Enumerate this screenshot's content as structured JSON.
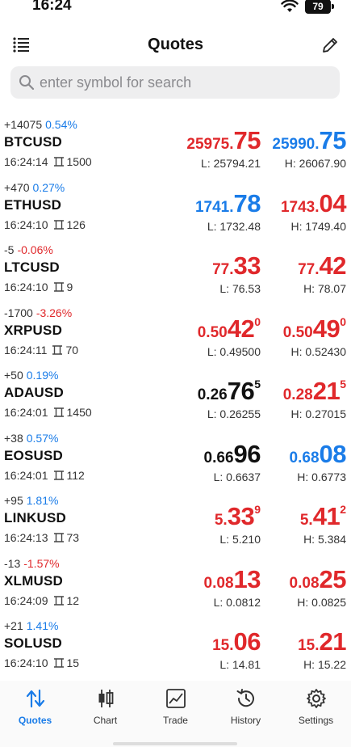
{
  "status": {
    "time": "16:24",
    "battery": "79"
  },
  "header": {
    "title": "Quotes",
    "menu_icon": "list-icon",
    "edit_icon": "pencil-icon"
  },
  "search": {
    "placeholder": "enter symbol for search",
    "icon": "search-icon"
  },
  "colors": {
    "up": "#1a7ce8",
    "down": "#e0282b",
    "neutral": "#111111"
  },
  "quotes": [
    {
      "change": "+14075",
      "pct": "0.54%",
      "dir": "up",
      "symbol": "BTCUSD",
      "time": "16:24:14",
      "spread": "1500",
      "bid": {
        "small": "25975.",
        "big": "75",
        "sup": "",
        "color": "red"
      },
      "ask": {
        "small": "25990.",
        "big": "75",
        "sup": "",
        "color": "blue"
      },
      "low": "L: 25794.21",
      "high": "H: 26067.90"
    },
    {
      "change": "+470",
      "pct": "0.27%",
      "dir": "up",
      "symbol": "ETHUSD",
      "time": "16:24:10",
      "spread": "126",
      "bid": {
        "small": "1741.",
        "big": "78",
        "sup": "",
        "color": "blue"
      },
      "ask": {
        "small": "1743.",
        "big": "04",
        "sup": "",
        "color": "red"
      },
      "low": "L: 1732.48",
      "high": "H: 1749.40"
    },
    {
      "change": "-5",
      "pct": "-0.06%",
      "dir": "down",
      "symbol": "LTCUSD",
      "time": "16:24:10",
      "spread": "9",
      "bid": {
        "small": "77.",
        "big": "33",
        "sup": "",
        "color": "red"
      },
      "ask": {
        "small": "77.",
        "big": "42",
        "sup": "",
        "color": "red"
      },
      "low": "L: 76.53",
      "high": "H: 78.07"
    },
    {
      "change": "-1700",
      "pct": "-3.26%",
      "dir": "down",
      "symbol": "XRPUSD",
      "time": "16:24:11",
      "spread": "70",
      "bid": {
        "small": "0.50",
        "big": "42",
        "sup": "0",
        "color": "red"
      },
      "ask": {
        "small": "0.50",
        "big": "49",
        "sup": "0",
        "color": "red"
      },
      "low": "L: 0.49500",
      "high": "H: 0.52430"
    },
    {
      "change": "+50",
      "pct": "0.19%",
      "dir": "up",
      "symbol": "ADAUSD",
      "time": "16:24:01",
      "spread": "1450",
      "bid": {
        "small": "0.26",
        "big": "76",
        "sup": "5",
        "color": "black"
      },
      "ask": {
        "small": "0.28",
        "big": "21",
        "sup": "5",
        "color": "red"
      },
      "low": "L: 0.26255",
      "high": "H: 0.27015"
    },
    {
      "change": "+38",
      "pct": "0.57%",
      "dir": "up",
      "symbol": "EOSUSD",
      "time": "16:24:01",
      "spread": "112",
      "bid": {
        "small": "0.66",
        "big": "96",
        "sup": "",
        "color": "black"
      },
      "ask": {
        "small": "0.68",
        "big": "08",
        "sup": "",
        "color": "blue"
      },
      "low": "L: 0.6637",
      "high": "H: 0.6773"
    },
    {
      "change": "+95",
      "pct": "1.81%",
      "dir": "up",
      "symbol": "LINKUSD",
      "time": "16:24:13",
      "spread": "73",
      "bid": {
        "small": "5.",
        "big": "33",
        "sup": "9",
        "color": "red"
      },
      "ask": {
        "small": "5.",
        "big": "41",
        "sup": "2",
        "color": "red"
      },
      "low": "L: 5.210",
      "high": "H: 5.384"
    },
    {
      "change": "-13",
      "pct": "-1.57%",
      "dir": "down",
      "symbol": "XLMUSD",
      "time": "16:24:09",
      "spread": "12",
      "bid": {
        "small": "0.08",
        "big": "13",
        "sup": "",
        "color": "red"
      },
      "ask": {
        "small": "0.08",
        "big": "25",
        "sup": "",
        "color": "red"
      },
      "low": "L: 0.0812",
      "high": "H: 0.0825"
    },
    {
      "change": "+21",
      "pct": "1.41%",
      "dir": "up",
      "symbol": "SOLUSD",
      "time": "16:24:10",
      "spread": "15",
      "bid": {
        "small": "15.",
        "big": "06",
        "sup": "",
        "color": "red"
      },
      "ask": {
        "small": "15.",
        "big": "21",
        "sup": "",
        "color": "red"
      },
      "low": "L: 14.81",
      "high": "H: 15.22"
    }
  ],
  "tabs": [
    {
      "label": "Quotes",
      "icon": "quotes-arrows-icon",
      "active": true
    },
    {
      "label": "Chart",
      "icon": "candlestick-icon",
      "active": false
    },
    {
      "label": "Trade",
      "icon": "trade-chart-icon",
      "active": false
    },
    {
      "label": "History",
      "icon": "history-clock-icon",
      "active": false
    },
    {
      "label": "Settings",
      "icon": "gear-icon",
      "active": false
    }
  ]
}
